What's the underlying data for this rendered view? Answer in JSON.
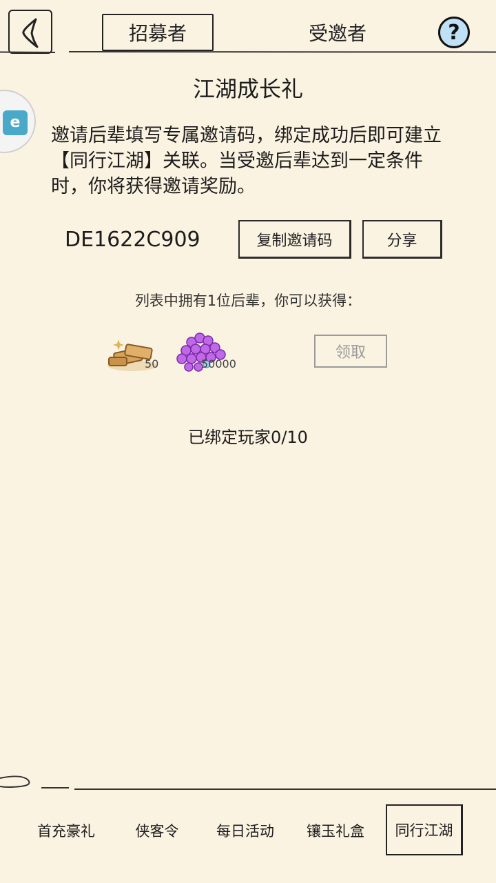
{
  "header": {
    "tabs": [
      {
        "label": "招募者",
        "active": true
      },
      {
        "label": "受邀者",
        "active": false
      }
    ],
    "help_icon": "question-mark-icon",
    "back_icon": "back-chevron-icon"
  },
  "main": {
    "title": "江湖成长礼",
    "description": "邀请后辈填写专属邀请码，绑定成功后即可建立【同行江湖】关联。当受邀后辈达到一定条件时，你将获得邀请奖励。",
    "invite_code": "DE1622C909",
    "copy_label": "复制邀请码",
    "share_label": "分享",
    "reward_caption": "列表中拥有1位后辈，你可以获得：",
    "rewards": [
      {
        "icon": "gold-ingot-icon",
        "quantity": "50"
      },
      {
        "icon": "purple-gem-icon",
        "quantity": "50000"
      }
    ],
    "claim_label": "领取",
    "bound_players": "已绑定玩家0/10"
  },
  "bottom_nav": {
    "items": [
      {
        "label": "首充豪礼"
      },
      {
        "label": "侠客令"
      },
      {
        "label": "每日活动"
      },
      {
        "label": "镶玉礼盒"
      },
      {
        "label": "同行江湖",
        "active": true
      }
    ]
  },
  "colors": {
    "background": "#fbf3e2",
    "help_icon_fill": "#bfe0f5",
    "disabled_text": "#9a9a9a"
  }
}
